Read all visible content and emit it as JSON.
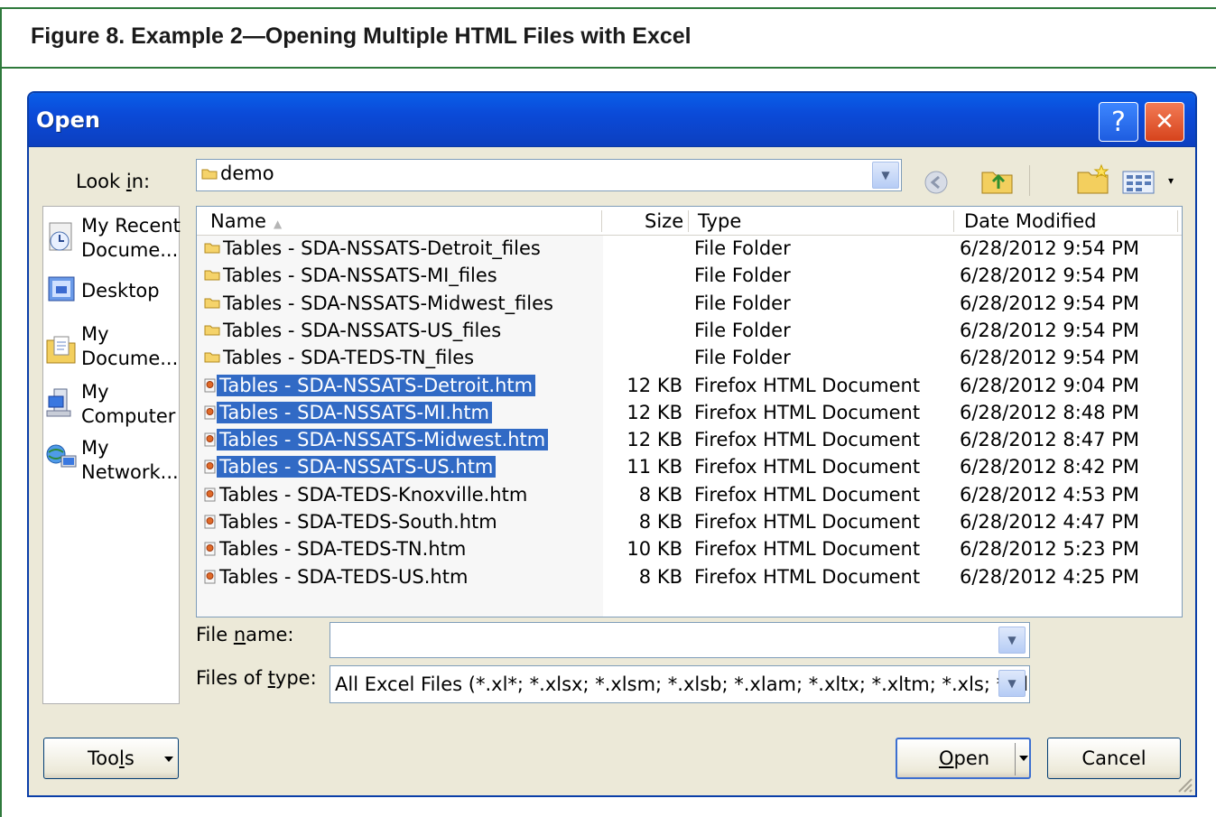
{
  "figure": {
    "title": "Figure 8. Example 2—Opening Multiple HTML Files with Excel"
  },
  "dialog": {
    "title": "Open",
    "help_glyph": "?",
    "close_glyph": "✕"
  },
  "lookin": {
    "label_pre": "Look ",
    "label_key": "i",
    "label_post": "n:",
    "value": "demo"
  },
  "places": [
    {
      "label": "My Recent\nDocume...",
      "icon": "recent-documents-icon"
    },
    {
      "label": "Desktop",
      "icon": "desktop-icon"
    },
    {
      "label": "My\nDocume...",
      "icon": "my-documents-icon"
    },
    {
      "label": "My\nComputer",
      "icon": "my-computer-icon"
    },
    {
      "label": "My\nNetwork...",
      "icon": "my-network-icon"
    }
  ],
  "columns": {
    "name": "Name",
    "size": "Size",
    "type": "Type",
    "date": "Date Modified"
  },
  "files": [
    {
      "name": "Tables - SDA-NSSATS-Detroit_files",
      "size": "",
      "type": "File Folder",
      "date": "6/28/2012 9:54 PM",
      "kind": "folder",
      "selected": false
    },
    {
      "name": "Tables - SDA-NSSATS-MI_files",
      "size": "",
      "type": "File Folder",
      "date": "6/28/2012 9:54 PM",
      "kind": "folder",
      "selected": false
    },
    {
      "name": "Tables - SDA-NSSATS-Midwest_files",
      "size": "",
      "type": "File Folder",
      "date": "6/28/2012 9:54 PM",
      "kind": "folder",
      "selected": false
    },
    {
      "name": "Tables - SDA-NSSATS-US_files",
      "size": "",
      "type": "File Folder",
      "date": "6/28/2012 9:54 PM",
      "kind": "folder",
      "selected": false
    },
    {
      "name": "Tables - SDA-TEDS-TN_files",
      "size": "",
      "type": "File Folder",
      "date": "6/28/2012 9:54 PM",
      "kind": "folder",
      "selected": false
    },
    {
      "name": "Tables - SDA-NSSATS-Detroit.htm",
      "size": "12 KB",
      "type": "Firefox HTML Document",
      "date": "6/28/2012 9:04 PM",
      "kind": "html",
      "selected": true
    },
    {
      "name": "Tables - SDA-NSSATS-MI.htm",
      "size": "12 KB",
      "type": "Firefox HTML Document",
      "date": "6/28/2012 8:48 PM",
      "kind": "html",
      "selected": true
    },
    {
      "name": "Tables - SDA-NSSATS-Midwest.htm",
      "size": "12 KB",
      "type": "Firefox HTML Document",
      "date": "6/28/2012 8:47 PM",
      "kind": "html",
      "selected": true
    },
    {
      "name": "Tables - SDA-NSSATS-US.htm",
      "size": "11 KB",
      "type": "Firefox HTML Document",
      "date": "6/28/2012 8:42 PM",
      "kind": "html",
      "selected": true
    },
    {
      "name": "Tables - SDA-TEDS-Knoxville.htm",
      "size": "8 KB",
      "type": "Firefox HTML Document",
      "date": "6/28/2012 4:53 PM",
      "kind": "html",
      "selected": false
    },
    {
      "name": "Tables - SDA-TEDS-South.htm",
      "size": "8 KB",
      "type": "Firefox HTML Document",
      "date": "6/28/2012 4:47 PM",
      "kind": "html",
      "selected": false
    },
    {
      "name": "Tables - SDA-TEDS-TN.htm",
      "size": "10 KB",
      "type": "Firefox HTML Document",
      "date": "6/28/2012 5:23 PM",
      "kind": "html",
      "selected": false
    },
    {
      "name": "Tables - SDA-TEDS-US.htm",
      "size": "8 KB",
      "type": "Firefox HTML Document",
      "date": "6/28/2012 4:25 PM",
      "kind": "html",
      "selected": false
    }
  ],
  "filename": {
    "label_pre": "File ",
    "label_key": "n",
    "label_post": "ame:",
    "value": ""
  },
  "filetype": {
    "label_pre": "Files of ",
    "label_key": "t",
    "label_post": "ype:",
    "value": "All Excel Files (*.xl*; *.xlsx; *.xlsm; *.xlsb; *.xlam; *.xltx; *.xltm; *.xls; *.xla; *.xlt; *.xlm; *.xlw)"
  },
  "buttons": {
    "tools_pre": "Too",
    "tools_key": "l",
    "tools_post": "s",
    "open_key": "O",
    "open_post": "pen",
    "cancel": "Cancel"
  },
  "colors": {
    "selection": "#316ac5",
    "titlebar": "#0b4ad8",
    "frame_green": "#2f7a3c"
  }
}
